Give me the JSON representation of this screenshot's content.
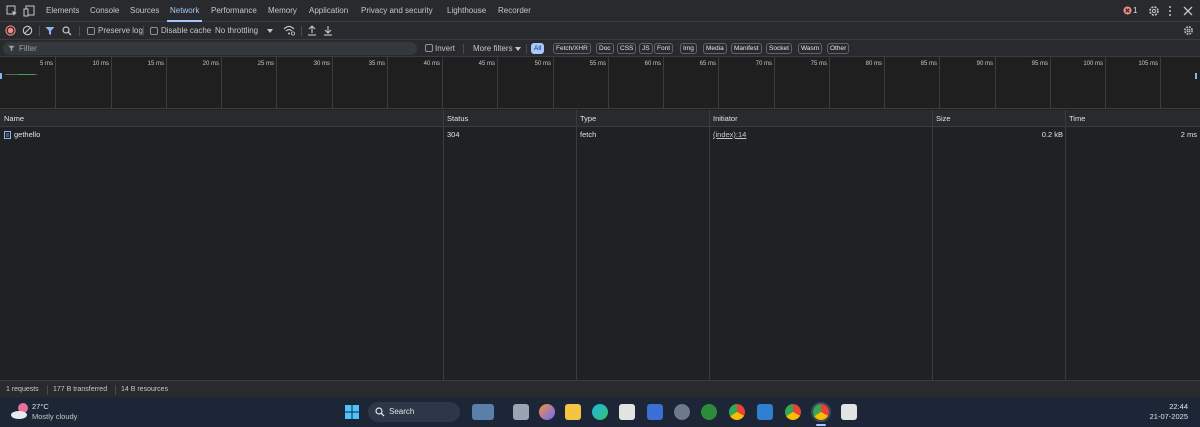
{
  "tabs": [
    {
      "label": "Elements",
      "active": false
    },
    {
      "label": "Console",
      "active": false
    },
    {
      "label": "Sources",
      "active": false
    },
    {
      "label": "Network",
      "active": true
    },
    {
      "label": "Performance",
      "active": false
    },
    {
      "label": "Memory",
      "active": false
    },
    {
      "label": "Application",
      "active": false
    },
    {
      "label": "Privacy and security",
      "active": false
    },
    {
      "label": "Lighthouse",
      "active": false
    },
    {
      "label": "Recorder",
      "active": false
    }
  ],
  "header_right": {
    "error_count": "1"
  },
  "toolbar": {
    "preserve_log": "Preserve log",
    "disable_cache": "Disable cache",
    "throttling": "No throttling"
  },
  "filter": {
    "placeholder": "Filter",
    "invert": "Invert",
    "more_filters": "More filters",
    "chips": [
      "All",
      "Fetch/XHR",
      "Doc",
      "CSS",
      "JS",
      "Font",
      "Img",
      "Media",
      "Manifest",
      "Socket",
      "Wasm",
      "Other"
    ],
    "active_chip": "All"
  },
  "overview": {
    "ticks": [
      "5 ms",
      "10 ms",
      "15 ms",
      "20 ms",
      "25 ms",
      "30 ms",
      "35 ms",
      "40 ms",
      "45 ms",
      "50 ms",
      "55 ms",
      "60 ms",
      "65 ms",
      "70 ms",
      "75 ms",
      "80 ms",
      "85 ms",
      "90 ms",
      "95 ms",
      "100 ms",
      "105 ms"
    ]
  },
  "table": {
    "columns": [
      "Name",
      "Status",
      "Type",
      "Initiator",
      "Size",
      "Time"
    ],
    "rows": [
      {
        "name": "gethello",
        "status": "304",
        "type": "fetch",
        "initiator": "(index):14",
        "size": "0.2 kB",
        "time": "2 ms"
      }
    ]
  },
  "status_bar": {
    "requests": "1 requests",
    "transferred": "177 B transferred",
    "resources": "14 B resources"
  },
  "taskbar": {
    "weather_temp": "27°C",
    "weather_desc": "Mostly cloudy",
    "search_label": "Search",
    "time": "22:44",
    "date": "21-07-2025"
  },
  "colors": {
    "accent": "#a8c7fa",
    "record": "#f28b82",
    "filter_icon": "#8ab4f8"
  }
}
